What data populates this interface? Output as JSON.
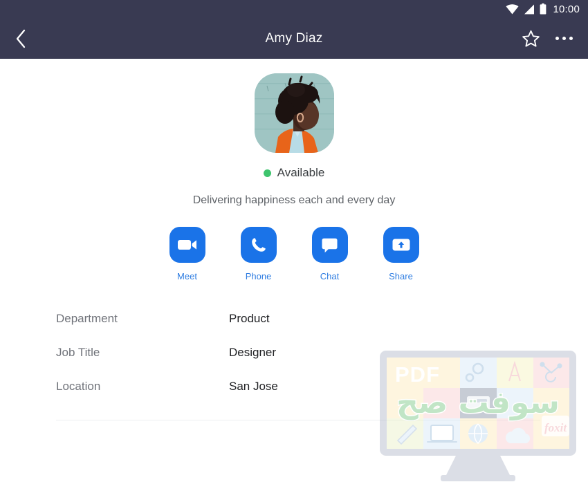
{
  "status_bar": {
    "time": "10:00",
    "icons": [
      "wifi-icon",
      "cellular-signal-icon",
      "battery-icon"
    ]
  },
  "app_bar": {
    "back_icon": "chevron-left-icon",
    "title": "Amy Diaz",
    "favorite_icon": "star-outline-icon",
    "overflow_icon": "more-options-icon"
  },
  "profile": {
    "avatar_alt": "contact-photo",
    "presence_status": "Available",
    "presence_color": "#3ec46d",
    "tagline": "Delivering happiness each and every day"
  },
  "actions": [
    {
      "label": "Meet",
      "icon": "video-camera-icon"
    },
    {
      "label": "Phone",
      "icon": "phone-handset-icon"
    },
    {
      "label": "Chat",
      "icon": "chat-bubble-icon"
    },
    {
      "label": "Share",
      "icon": "share-upload-icon"
    }
  ],
  "details": [
    {
      "label": "Department",
      "value": "Product"
    },
    {
      "label": "Job Title",
      "value": "Designer"
    },
    {
      "label": "Location",
      "value": "San Jose"
    }
  ],
  "theme": {
    "app_bar_bg": "#393a52",
    "accent_blue": "#1a73e8",
    "link_blue": "#2f7de1"
  },
  "watermark": {
    "pdf_text": "PDF",
    "arabic_text": "سوفت صح",
    "brand": "foxit"
  }
}
